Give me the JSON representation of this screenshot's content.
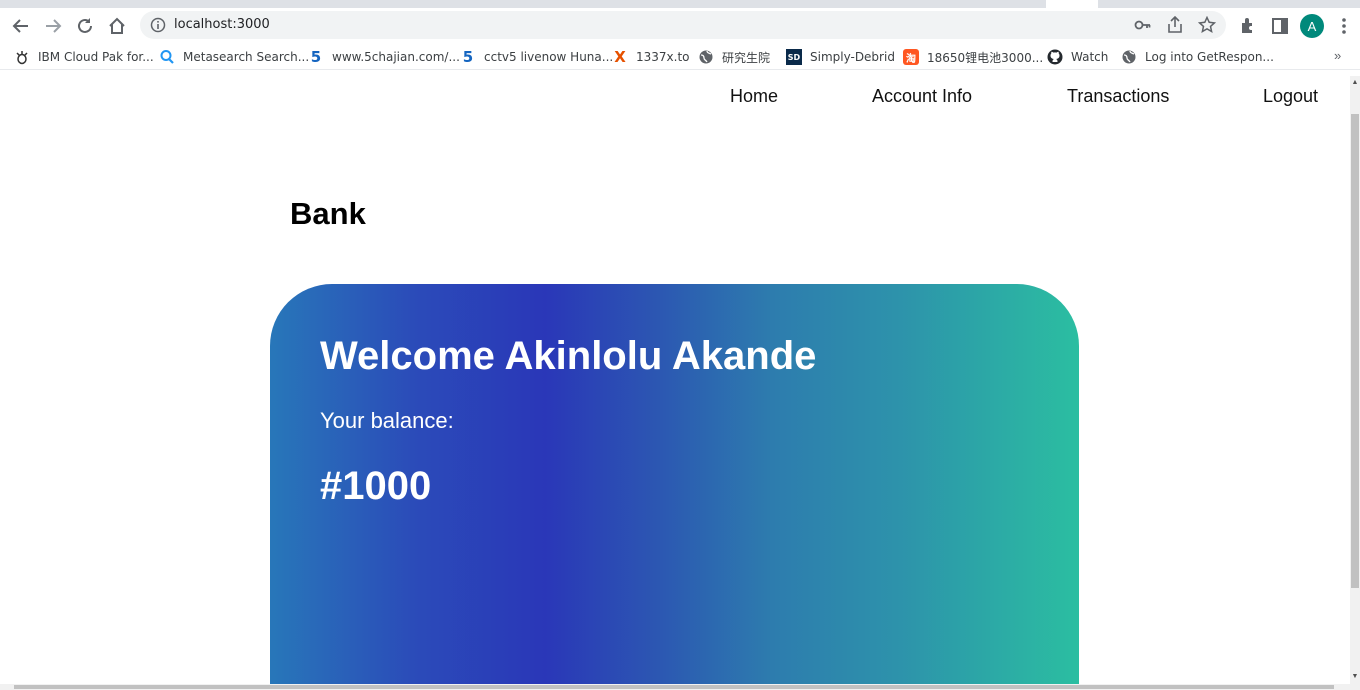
{
  "browser": {
    "url": "localhost:3000",
    "avatar_initial": "A",
    "bookmarks": [
      {
        "label": "IBM Cloud Pak for...",
        "icon": "ibm-bee-icon"
      },
      {
        "label": "Metasearch Search...",
        "icon": "magnifier-icon"
      },
      {
        "label": "www.5chajian.com/...",
        "icon": "five-logo-icon"
      },
      {
        "label": "cctv5 livenow Huna...",
        "icon": "five-logo-icon"
      },
      {
        "label": "1337x.to",
        "icon": "x-logo-icon"
      },
      {
        "label": "研究生院",
        "icon": "globe-icon"
      },
      {
        "label": "Simply-Debrid",
        "icon": "sd-logo-icon"
      },
      {
        "label": "18650锂电池3000...",
        "icon": "taobao-icon"
      },
      {
        "label": "Watch",
        "icon": "github-icon"
      },
      {
        "label": "Log into GetRespon...",
        "icon": "globe-icon"
      }
    ]
  },
  "page": {
    "nav": [
      "Home",
      "Account Info",
      "Transactions",
      "Logout"
    ],
    "title": "Bank",
    "card": {
      "welcome": "Welcome Akinlolu Akande",
      "balance_label": "Your balance:",
      "balance_amount": "#1000"
    }
  },
  "colors": {
    "card_gradient": [
      "#2877b9",
      "#2a37b8",
      "#2d7cae",
      "#2bbea1"
    ],
    "avatar": "#00897b"
  }
}
